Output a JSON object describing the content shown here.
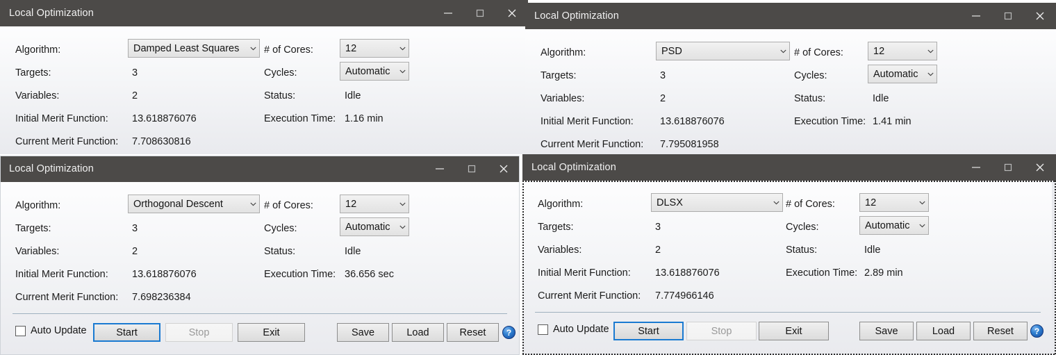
{
  "windows": [
    {
      "id": "top-left",
      "title": "Local Optimization",
      "fields": {
        "algorithm_label": "Algorithm:",
        "algorithm_value": "Damped Least Squares",
        "cores_label": "# of Cores:",
        "cores_value": "12",
        "targets_label": "Targets:",
        "targets_value": "3",
        "cycles_label": "Cycles:",
        "cycles_value": "Automatic",
        "variables_label": "Variables:",
        "variables_value": "2",
        "status_label": "Status:",
        "status_value": "Idle",
        "initial_merit_label": "Initial Merit Function:",
        "initial_merit_value": "13.618876076",
        "execution_time_label": "Execution Time:",
        "execution_time_value": "1.16 min",
        "current_merit_label": "Current Merit Function:",
        "current_merit_value": "7.708630816"
      }
    },
    {
      "id": "top-right",
      "title": "Local Optimization",
      "fields": {
        "algorithm_label": "Algorithm:",
        "algorithm_value": "PSD",
        "cores_label": "# of Cores:",
        "cores_value": "12",
        "targets_label": "Targets:",
        "targets_value": "3",
        "cycles_label": "Cycles:",
        "cycles_value": "Automatic",
        "variables_label": "Variables:",
        "variables_value": "2",
        "status_label": "Status:",
        "status_value": "Idle",
        "initial_merit_label": "Initial Merit Function:",
        "initial_merit_value": "13.618876076",
        "execution_time_label": "Execution Time:",
        "execution_time_value": "1.41 min",
        "current_merit_label": "Current Merit Function:",
        "current_merit_value": "7.795081958"
      }
    },
    {
      "id": "bottom-left",
      "title": "Local Optimization",
      "fields": {
        "algorithm_label": "Algorithm:",
        "algorithm_value": "Orthogonal Descent",
        "cores_label": "# of Cores:",
        "cores_value": "12",
        "targets_label": "Targets:",
        "targets_value": "3",
        "cycles_label": "Cycles:",
        "cycles_value": "Automatic",
        "variables_label": "Variables:",
        "variables_value": "2",
        "status_label": "Status:",
        "status_value": "Idle",
        "initial_merit_label": "Initial Merit Function:",
        "initial_merit_value": "13.618876076",
        "execution_time_label": "Execution Time:",
        "execution_time_value": "36.656 sec",
        "current_merit_label": "Current Merit Function:",
        "current_merit_value": "7.698236384"
      },
      "footer": {
        "auto_update_label": "Auto Update",
        "auto_update_checked": false,
        "start_label": "Start",
        "stop_label": "Stop",
        "stop_disabled": true,
        "exit_label": "Exit",
        "save_label": "Save",
        "load_label": "Load",
        "reset_label": "Reset",
        "help_label": "?"
      }
    },
    {
      "id": "bottom-right",
      "title": "Local Optimization",
      "fields": {
        "algorithm_label": "Algorithm:",
        "algorithm_value": "DLSX",
        "cores_label": "# of Cores:",
        "cores_value": "12",
        "targets_label": "Targets:",
        "targets_value": "3",
        "cycles_label": "Cycles:",
        "cycles_value": "Automatic",
        "variables_label": "Variables:",
        "variables_value": "2",
        "status_label": "Status:",
        "status_value": "Idle",
        "initial_merit_label": "Initial Merit Function:",
        "initial_merit_value": "13.618876076",
        "execution_time_label": "Execution Time:",
        "execution_time_value": "2.89 min",
        "current_merit_label": "Current Merit Function:",
        "current_merit_value": "7.774966146"
      },
      "footer": {
        "auto_update_label": "Auto Update",
        "auto_update_checked": false,
        "start_label": "Start",
        "stop_label": "Stop",
        "stop_disabled": true,
        "exit_label": "Exit",
        "save_label": "Save",
        "load_label": "Load",
        "reset_label": "Reset",
        "help_label": "?"
      }
    }
  ],
  "caption": {
    "minimize": "minimize",
    "maximize": "maximize",
    "close": "close"
  },
  "colors": {
    "titlebar": "#4c4a48",
    "accent": "#1a7ad1",
    "help_blue": "#2f7fd0"
  }
}
